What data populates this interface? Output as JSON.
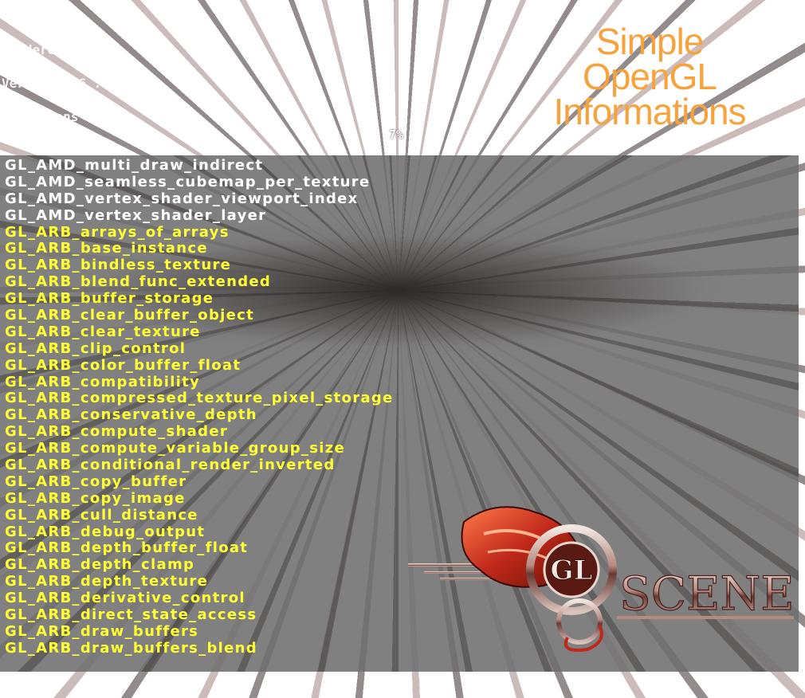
{
  "title": {
    "line1": "Simple",
    "line2": "OpenGL",
    "line3": "Informations"
  },
  "header": {
    "lines": [
      "Vendor ...",
      "Renderer ...",
      "Version 4.6 ...",
      "Extensions ...",
      "Extension count ..."
    ],
    "progress": "7%"
  },
  "extensions": [
    {
      "name": "GL_AMD_multi_draw_indirect",
      "supported": false
    },
    {
      "name": "GL_AMD_seamless_cubemap_per_texture",
      "supported": false
    },
    {
      "name": "GL_AMD_vertex_shader_viewport_index",
      "supported": false
    },
    {
      "name": "GL_AMD_vertex_shader_layer",
      "supported": false
    },
    {
      "name": "GL_ARB_arrays_of_arrays",
      "supported": true
    },
    {
      "name": "GL_ARB_base_instance",
      "supported": true
    },
    {
      "name": "GL_ARB_bindless_texture",
      "supported": true
    },
    {
      "name": "GL_ARB_blend_func_extended",
      "supported": true
    },
    {
      "name": "GL_ARB_buffer_storage",
      "supported": true
    },
    {
      "name": "GL_ARB_clear_buffer_object",
      "supported": true
    },
    {
      "name": "GL_ARB_clear_texture",
      "supported": true
    },
    {
      "name": "GL_ARB_clip_control",
      "supported": true
    },
    {
      "name": "GL_ARB_color_buffer_float",
      "supported": true
    },
    {
      "name": "GL_ARB_compatibility",
      "supported": true
    },
    {
      "name": "GL_ARB_compressed_texture_pixel_storage",
      "supported": true
    },
    {
      "name": "GL_ARB_conservative_depth",
      "supported": true
    },
    {
      "name": "GL_ARB_compute_shader",
      "supported": true
    },
    {
      "name": "GL_ARB_compute_variable_group_size",
      "supported": true
    },
    {
      "name": "GL_ARB_conditional_render_inverted",
      "supported": true
    },
    {
      "name": "GL_ARB_copy_buffer",
      "supported": true
    },
    {
      "name": "GL_ARB_copy_image",
      "supported": true
    },
    {
      "name": "GL_ARB_cull_distance",
      "supported": true
    },
    {
      "name": "GL_ARB_debug_output",
      "supported": true
    },
    {
      "name": "GL_ARB_depth_buffer_float",
      "supported": true
    },
    {
      "name": "GL_ARB_depth_clamp",
      "supported": true
    },
    {
      "name": "GL_ARB_depth_texture",
      "supported": true
    },
    {
      "name": "GL_ARB_derivative_control",
      "supported": true
    },
    {
      "name": "GL_ARB_direct_state_access",
      "supported": true
    },
    {
      "name": "GL_ARB_draw_buffers",
      "supported": true
    },
    {
      "name": "GL_ARB_draw_buffers_blend",
      "supported": true
    }
  ],
  "logo": {
    "text_gl": "GL",
    "text_scene": "SCENE"
  },
  "colors": {
    "title": "#f7a23c",
    "supported_text": "#ffff33",
    "unsupported_text": "#ffffff",
    "panel": "#6e6e6e"
  }
}
